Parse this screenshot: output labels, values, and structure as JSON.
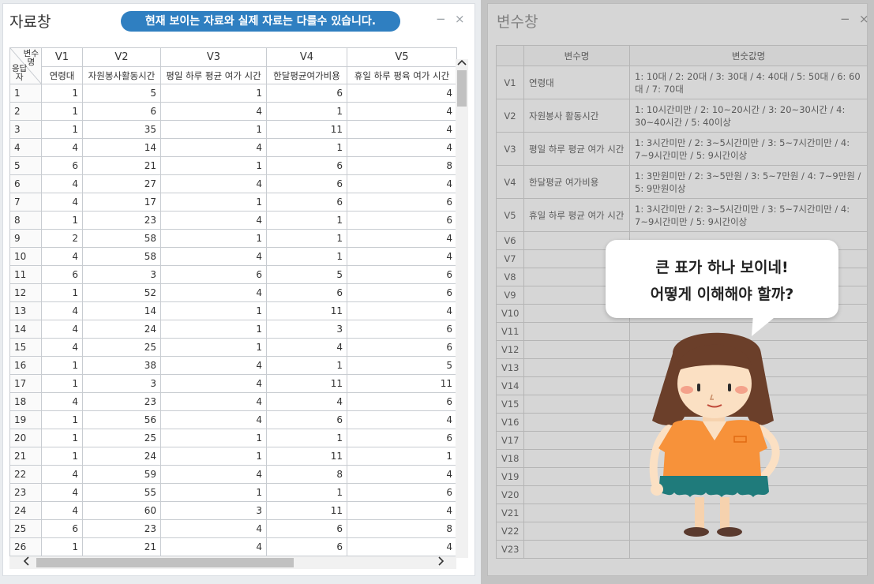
{
  "data_window": {
    "title": "자료창",
    "notice": "현재 보이는 자료와 실제 자료는 다를수 있습니다.",
    "minimize": "−",
    "close": "×",
    "corner_top": "변수\n명",
    "corner_bottom": "응답\n자",
    "columns": [
      {
        "id": "V1",
        "label": "연령대"
      },
      {
        "id": "V2",
        "label": "자원봉사활동시간"
      },
      {
        "id": "V3",
        "label": "평일 하루 평균 여가 시간"
      },
      {
        "id": "V4",
        "label": "한달평균여가비용"
      },
      {
        "id": "V5",
        "label": "휴일 하루 평육 여가 시간"
      }
    ],
    "rows": [
      [
        "1",
        "1",
        "5",
        "1",
        "6",
        "4"
      ],
      [
        "2",
        "1",
        "6",
        "4",
        "1",
        "4"
      ],
      [
        "3",
        "1",
        "35",
        "1",
        "11",
        "4"
      ],
      [
        "4",
        "4",
        "14",
        "4",
        "1",
        "4"
      ],
      [
        "5",
        "6",
        "21",
        "1",
        "6",
        "8"
      ],
      [
        "6",
        "4",
        "27",
        "4",
        "6",
        "4"
      ],
      [
        "7",
        "4",
        "17",
        "1",
        "6",
        "6"
      ],
      [
        "8",
        "1",
        "23",
        "4",
        "1",
        "6"
      ],
      [
        "9",
        "2",
        "58",
        "1",
        "1",
        "4"
      ],
      [
        "10",
        "4",
        "58",
        "4",
        "1",
        "4"
      ],
      [
        "11",
        "6",
        "3",
        "6",
        "5",
        "6"
      ],
      [
        "12",
        "1",
        "52",
        "4",
        "6",
        "6"
      ],
      [
        "13",
        "4",
        "14",
        "1",
        "11",
        "4"
      ],
      [
        "14",
        "4",
        "24",
        "1",
        "3",
        "6"
      ],
      [
        "15",
        "4",
        "25",
        "1",
        "4",
        "6"
      ],
      [
        "16",
        "1",
        "38",
        "4",
        "1",
        "5"
      ],
      [
        "17",
        "1",
        "3",
        "4",
        "11",
        "11"
      ],
      [
        "18",
        "4",
        "23",
        "4",
        "4",
        "6"
      ],
      [
        "19",
        "1",
        "56",
        "4",
        "6",
        "4"
      ],
      [
        "20",
        "1",
        "25",
        "1",
        "1",
        "6"
      ],
      [
        "21",
        "1",
        "24",
        "1",
        "11",
        "1"
      ],
      [
        "22",
        "4",
        "59",
        "4",
        "8",
        "4"
      ],
      [
        "23",
        "4",
        "55",
        "1",
        "1",
        "6"
      ],
      [
        "24",
        "4",
        "60",
        "3",
        "11",
        "4"
      ],
      [
        "25",
        "6",
        "23",
        "4",
        "6",
        "8"
      ],
      [
        "26",
        "1",
        "21",
        "4",
        "6",
        "4"
      ]
    ]
  },
  "variable_window": {
    "title": "변수창",
    "minimize": "−",
    "close": "×",
    "header_name": "변수명",
    "header_values": "변숫값명",
    "variables": [
      {
        "id": "V1",
        "name": "연령대",
        "values": "1: 10대 / 2: 20대 / 3: 30대 / 4: 40대 / 5: 50대 / 6: 60대 / 7: 70대"
      },
      {
        "id": "V2",
        "name": "자원봉사 활동시간",
        "values": "1: 10시간미만 / 2: 10~20시간 / 3: 20~30시간 / 4: 30~40시간 / 5: 40이상"
      },
      {
        "id": "V3",
        "name": "평일 하루 평균 여가 시간",
        "values": "1: 3시간미만 / 2: 3~5시간미만 / 3: 5~7시간미만 / 4: 7~9시간미만 / 5: 9시간이상"
      },
      {
        "id": "V4",
        "name": "한달평균 여가비용",
        "values": "1: 3만원미만 / 2: 3~5만원 / 3: 5~7만원 / 4: 7~9만원 / 5: 9만원이상"
      },
      {
        "id": "V5",
        "name": "휴일 하루 평균 여가 시간",
        "values": "1: 3시간미만 / 2: 3~5시간미만 / 3: 5~7시간미만 / 4: 7~9시간미만 / 5: 9시간이상"
      }
    ],
    "empty_ids": [
      "V6",
      "V7",
      "V8",
      "V9",
      "V10",
      "V11",
      "V12",
      "V13",
      "V14",
      "V15",
      "V16",
      "V17",
      "V18",
      "V19",
      "V20",
      "V21",
      "V22",
      "V23"
    ]
  },
  "bubble": {
    "line1": "큰 표가 하나 보이네!",
    "line2": "어떻게 이해해야 할까?"
  },
  "colors": {
    "notice_bg": "#2f7fc1",
    "character_shirt": "#f7923a",
    "character_skirt": "#1f7b7b",
    "character_hair": "#6b3f2a"
  },
  "icons": {
    "scroll_up": "chevron-up-icon",
    "scroll_left": "chevron-left-icon",
    "scroll_right": "chevron-right-icon"
  }
}
